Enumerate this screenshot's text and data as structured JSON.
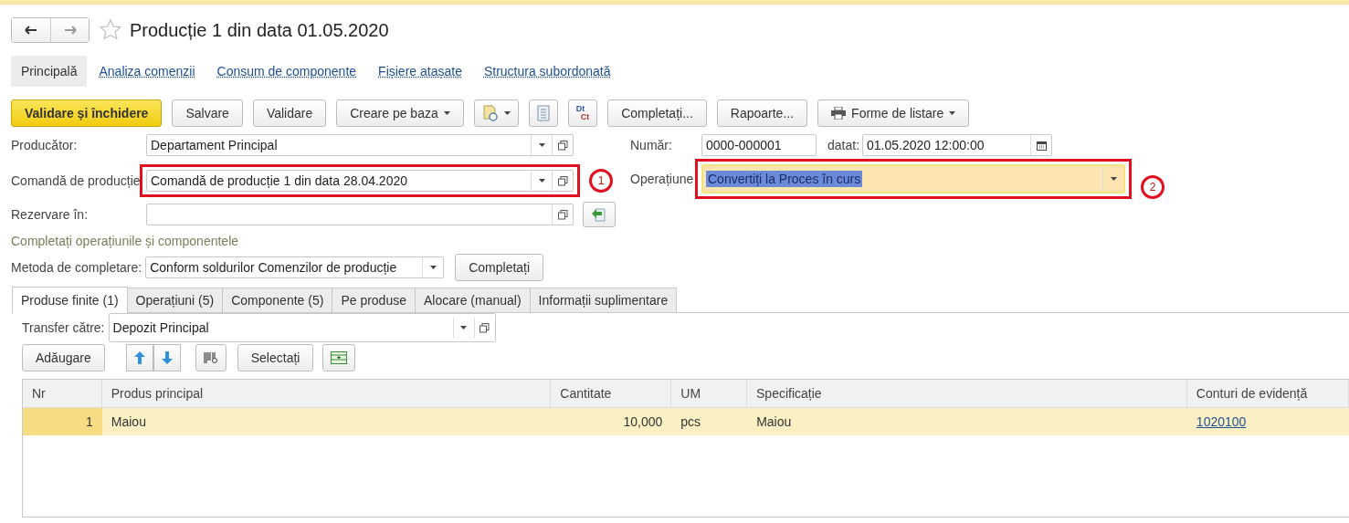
{
  "title": "Producție 1 din data 01.05.2020",
  "favorite": false,
  "nav": [
    {
      "label": "Principală",
      "selected": true
    },
    {
      "label": "Analiza comenzii",
      "selected": false
    },
    {
      "label": "Consum de componente",
      "selected": false
    },
    {
      "label": "Fișiere atașate",
      "selected": false
    },
    {
      "label": "Structura subordonată",
      "selected": false
    }
  ],
  "toolbar": [
    {
      "kind": "primary",
      "label": "Validare și închidere"
    },
    {
      "kind": "button",
      "label": "Salvare"
    },
    {
      "kind": "button",
      "label": "Validare"
    },
    {
      "kind": "menu",
      "label": "Creare pe baza"
    },
    {
      "kind": "doc-menu"
    },
    {
      "kind": "doc"
    },
    {
      "kind": "dtct",
      "label": "Dt",
      "sub": "Ct"
    },
    {
      "kind": "button",
      "label": "Completați..."
    },
    {
      "kind": "button",
      "label": "Rapoarte..."
    },
    {
      "kind": "print-menu",
      "label": "Forme de listare"
    }
  ],
  "left_fields": [
    {
      "label": "Producător:",
      "value": "Departament Principal",
      "dropdown": true,
      "action": false
    },
    {
      "label": "Comandă de producție",
      "value": "Comandă de producție 1 din data 28.04.2020",
      "dropdown": true,
      "action": false,
      "annotation": "1"
    },
    {
      "label": "Rezervare în:",
      "dropdown": false,
      "action": true
    }
  ],
  "number": {
    "label": "Număr:",
    "value": "0000-000001"
  },
  "date": {
    "label": "datat:",
    "value": "01.05.2020 12:00:00"
  },
  "operation": {
    "label": "Operațiune",
    "value": "Convertiți la Proces în curs",
    "focused": true,
    "annotation": "2"
  },
  "section_title": "Completați operațiunile și componentele",
  "method": {
    "label": "Metoda de completare:",
    "value": "Conform soldurilor Comenzilor de producție",
    "button": "Completați"
  },
  "tabs": [
    {
      "label": "Produse finite (1)",
      "selected": true
    },
    {
      "label": "Operațiuni (5)",
      "selected": false
    },
    {
      "label": "Componente (5)",
      "selected": false
    },
    {
      "label": "Pe produse",
      "selected": false
    },
    {
      "label": "Alocare (manual)",
      "selected": false
    },
    {
      "label": "Informații suplimentare",
      "selected": false
    }
  ],
  "transfer": {
    "label": "Transfer către:",
    "value": "Depozit Principal"
  },
  "table_toolbar": [
    {
      "kind": "button",
      "label": "Adăugare"
    },
    {
      "kind": "updown"
    },
    {
      "kind": "barcode"
    },
    {
      "kind": "button",
      "label": "Selectați"
    },
    {
      "kind": "fill"
    }
  ],
  "table": {
    "columns": [
      "Nr",
      "Produs principal",
      "Cantitate",
      "UM",
      "Specificație",
      "Conturi de evidență"
    ],
    "rows": [
      {
        "selected": true,
        "cells": [
          "1",
          "Maiou",
          "10,000",
          "pcs",
          "Maiou",
          "1020100"
        ]
      }
    ]
  }
}
